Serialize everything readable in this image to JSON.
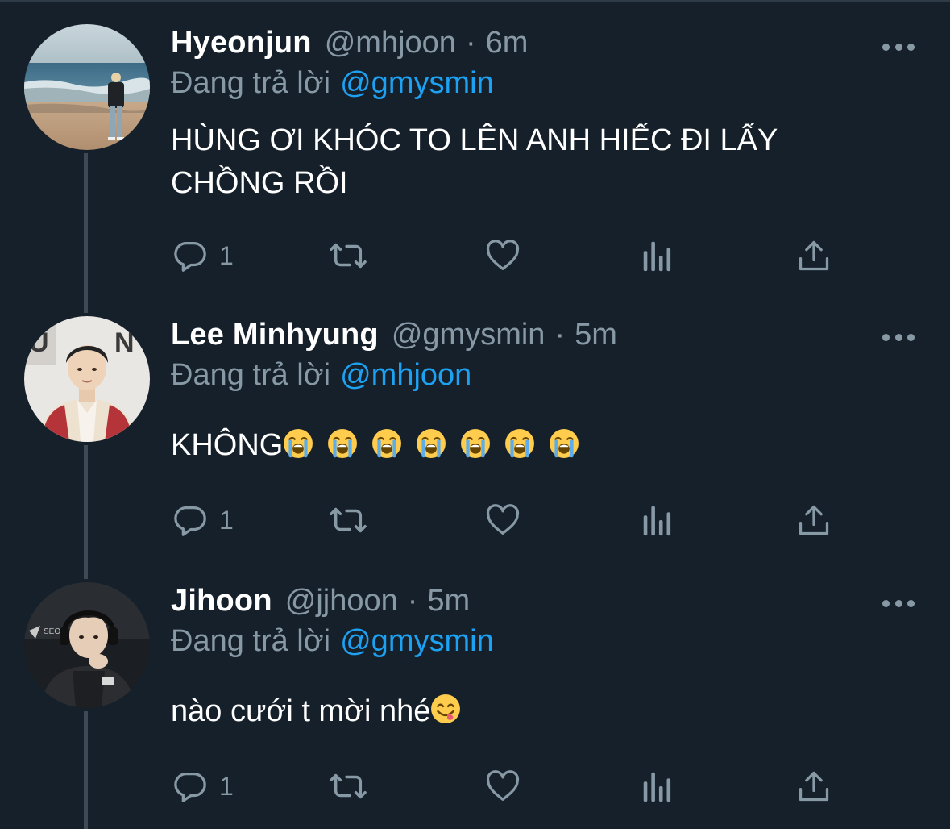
{
  "tweets": [
    {
      "display_name": "Hyeonjun",
      "handle": "@mhjoon",
      "separator": "·",
      "time": "6m",
      "reply_prefix": "Đang trả lời",
      "reply_handle": "@gmysmin",
      "body_lines": [
        "HÙNG ƠI KHÓC TO LÊN ANH HIẾC ĐI LẤY",
        "CHỒNG RỒI"
      ],
      "reply_count": "1",
      "avatar": "beach-photo"
    },
    {
      "display_name": "Lee Minhyung",
      "handle": "@gmysmin",
      "separator": "·",
      "time": "5m",
      "reply_prefix": "Đang trả lời",
      "reply_handle": "@mhjoon",
      "body_text": "KHÔNG",
      "body_emoji": "loudly-crying-face",
      "body_emoji_count": 7,
      "reply_count": "1",
      "avatar": "person-photo"
    },
    {
      "display_name": "Jihoon",
      "handle": "@jjhoon",
      "separator": "·",
      "time": "5m",
      "reply_prefix": "Đang trả lời",
      "reply_handle": "@gmysmin",
      "body_text": "nào cưới t mời nhé",
      "body_emoji": "face-savoring-food",
      "reply_count": "1",
      "avatar": "gamer-photo"
    }
  ],
  "icons": {
    "reply": "reply-icon",
    "retweet": "retweet-icon",
    "like": "heart-icon",
    "analytics": "analytics-icon",
    "share": "share-icon",
    "more": "more-icon"
  },
  "colors": {
    "background": "#15202b",
    "secondary_text": "#8899a6",
    "link": "#1da1f2",
    "thread_line": "#3d4a56"
  }
}
